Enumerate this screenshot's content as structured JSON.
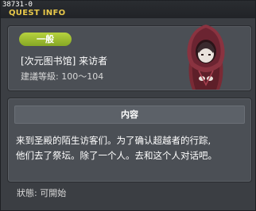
{
  "window": {
    "quest_id": "38731-0",
    "title": "QUEST INFO"
  },
  "quest": {
    "category_badge": "一般",
    "title": "[次元图书馆] 来访者",
    "level_requirement": "建議等級: 100～104",
    "npc_icon": "hooded-figure-portrait"
  },
  "content": {
    "header": "内容",
    "description_lines": [
      "来到圣殿的陌生访客们。为了确认超越者的行踪,",
      "他们去了祭坛。除了一个人。去和这个人对话吧。"
    ]
  },
  "status": {
    "text": "狀態: 可開始"
  },
  "colors": {
    "accent_title": "#e8c84a",
    "badge_green": "#9cbc2f",
    "panel_bg": "#4b4f55",
    "window_bg": "#3b3e43"
  }
}
